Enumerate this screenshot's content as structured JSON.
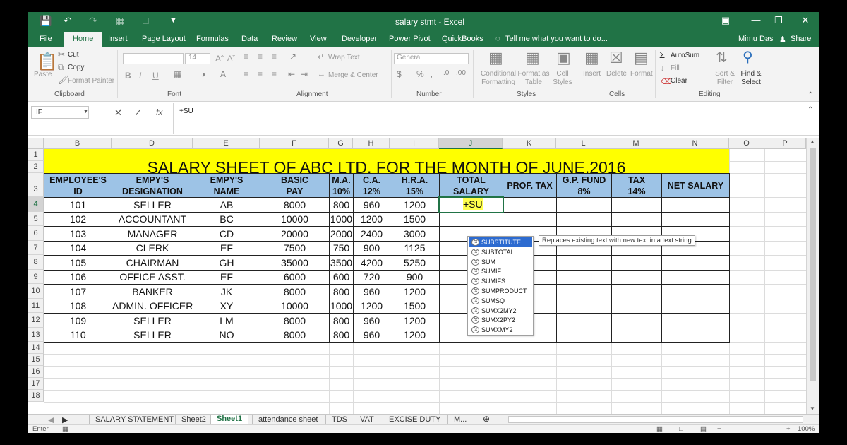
{
  "window": {
    "title": "salary stmt - Excel",
    "user": "Mimu Das",
    "share": "Share"
  },
  "tabs": [
    "File",
    "Home",
    "Insert",
    "Page Layout",
    "Formulas",
    "Data",
    "Review",
    "View",
    "Developer",
    "Power Pivot",
    "QuickBooks"
  ],
  "tell_me": "Tell me what you want to do...",
  "ribbon": {
    "clipboard": {
      "label": "Clipboard",
      "paste": "Paste",
      "cut": "Cut",
      "copy": "Copy",
      "format_painter": "Format Painter"
    },
    "font": {
      "label": "Font",
      "size": "14",
      "bold": "B",
      "italic": "I",
      "underline": "U"
    },
    "alignment": {
      "label": "Alignment",
      "wrap_text": "Wrap Text",
      "merge_center": "Merge & Center"
    },
    "number": {
      "label": "Number",
      "format": "General"
    },
    "styles": {
      "label": "Styles",
      "conditional": "Conditional Formatting",
      "format_table": "Format as Table",
      "cell_styles": "Cell Styles"
    },
    "cells": {
      "label": "Cells",
      "insert": "Insert",
      "delete": "Delete",
      "format": "Format"
    },
    "editing": {
      "label": "Editing",
      "autosum": "AutoSum",
      "fill": "Fill",
      "clear": "Clear",
      "sort_filter": "Sort & Filter",
      "find_select": "Find & Select"
    }
  },
  "formula_bar": {
    "name_box": "IF",
    "content": "+SU"
  },
  "columns": [
    "B",
    "D",
    "E",
    "F",
    "G",
    "H",
    "I",
    "J",
    "K",
    "L",
    "M",
    "N",
    "O",
    "P"
  ],
  "rows": [
    "1",
    "2",
    "3",
    "4",
    "5",
    "6",
    "7",
    "8",
    "9",
    "10",
    "11",
    "12",
    "13",
    "14",
    "15",
    "16",
    "17",
    "18"
  ],
  "sheet": {
    "title": "SALARY SHEET OF ABC LTD. FOR THE MONTH OF JUNE,2016",
    "headers": [
      [
        "EMPLOYEE'S",
        "ID"
      ],
      [
        "EMPY'S",
        "DESIGNATION"
      ],
      [
        "EMPY'S",
        "NAME"
      ],
      [
        "BASIC",
        "PAY"
      ],
      [
        "M.A.",
        "10%"
      ],
      [
        "C.A.",
        "12%"
      ],
      [
        "H.R.A.",
        "15%"
      ],
      [
        "TOTAL",
        "SALARY"
      ],
      [
        "PROF. TAX",
        ""
      ],
      [
        "G.P. FUND",
        "8%"
      ],
      [
        "TAX",
        "14%"
      ],
      [
        "NET SALARY",
        ""
      ]
    ],
    "data": [
      [
        "101",
        "SELLER",
        "AB",
        "8000",
        "800",
        "960",
        "1200"
      ],
      [
        "102",
        "ACCOUNTANT",
        "BC",
        "10000",
        "1000",
        "1200",
        "1500"
      ],
      [
        "103",
        "MANAGER",
        "CD",
        "20000",
        "2000",
        "2400",
        "3000"
      ],
      [
        "104",
        "CLERK",
        "EF",
        "7500",
        "750",
        "900",
        "1125"
      ],
      [
        "105",
        "CHAIRMAN",
        "GH",
        "35000",
        "3500",
        "4200",
        "5250"
      ],
      [
        "106",
        "OFFICE ASST.",
        "EF",
        "6000",
        "600",
        "720",
        "900"
      ],
      [
        "107",
        "BANKER",
        "JK",
        "8000",
        "800",
        "960",
        "1200"
      ],
      [
        "108",
        "ADMIN. OFFICER",
        "XY",
        "10000",
        "1000",
        "1200",
        "1500"
      ],
      [
        "109",
        "SELLER",
        "LM",
        "8000",
        "800",
        "960",
        "1200"
      ],
      [
        "110",
        "SELLER",
        "NO",
        "8000",
        "800",
        "960",
        "1200"
      ]
    ],
    "active_entry": "+SU"
  },
  "autocomplete": {
    "items": [
      "SUBSTITUTE",
      "SUBTOTAL",
      "SUM",
      "SUMIF",
      "SUMIFS",
      "SUMPRODUCT",
      "SUMSQ",
      "SUMX2MY2",
      "SUMX2PY2",
      "SUMXMY2"
    ],
    "tooltip": "Replaces existing text with new text in a text string"
  },
  "sheet_tabs": [
    "SALARY STATEMENT",
    "Sheet2",
    "Sheet1",
    "attendance sheet",
    "TDS",
    "VAT",
    "EXCISE DUTY",
    "M..."
  ],
  "active_sheet_tab": "Sheet1",
  "status": {
    "mode": "Enter",
    "zoom": "100%"
  },
  "colors": {
    "accent": "#217346",
    "title_band": "#ffff00",
    "header_fill": "#9dc3e6",
    "highlight": "#2d6bd0"
  }
}
